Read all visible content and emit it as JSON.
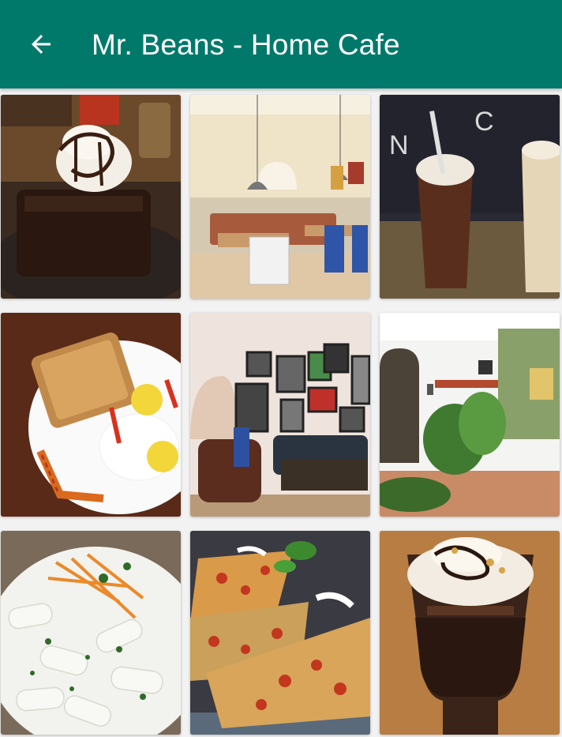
{
  "appbar": {
    "title": "Mr. Beans - Home Cafe",
    "back_icon": "arrow-left-icon",
    "background": "#00796b"
  },
  "gallery": {
    "photos": [
      {
        "subject": "chocolate-brownie-with-ice-cream"
      },
      {
        "subject": "cafe-interior-seating"
      },
      {
        "subject": "iced-chocolate-drinks"
      },
      {
        "subject": "toast-and-fried-eggs"
      },
      {
        "subject": "lounge-with-framed-pictures"
      },
      {
        "subject": "courtyard-entrance-with-plants"
      },
      {
        "subject": "penne-pasta-in-white-sauce"
      },
      {
        "subject": "loaded-nachos"
      },
      {
        "subject": "cold-coffee-with-cream"
      }
    ]
  }
}
